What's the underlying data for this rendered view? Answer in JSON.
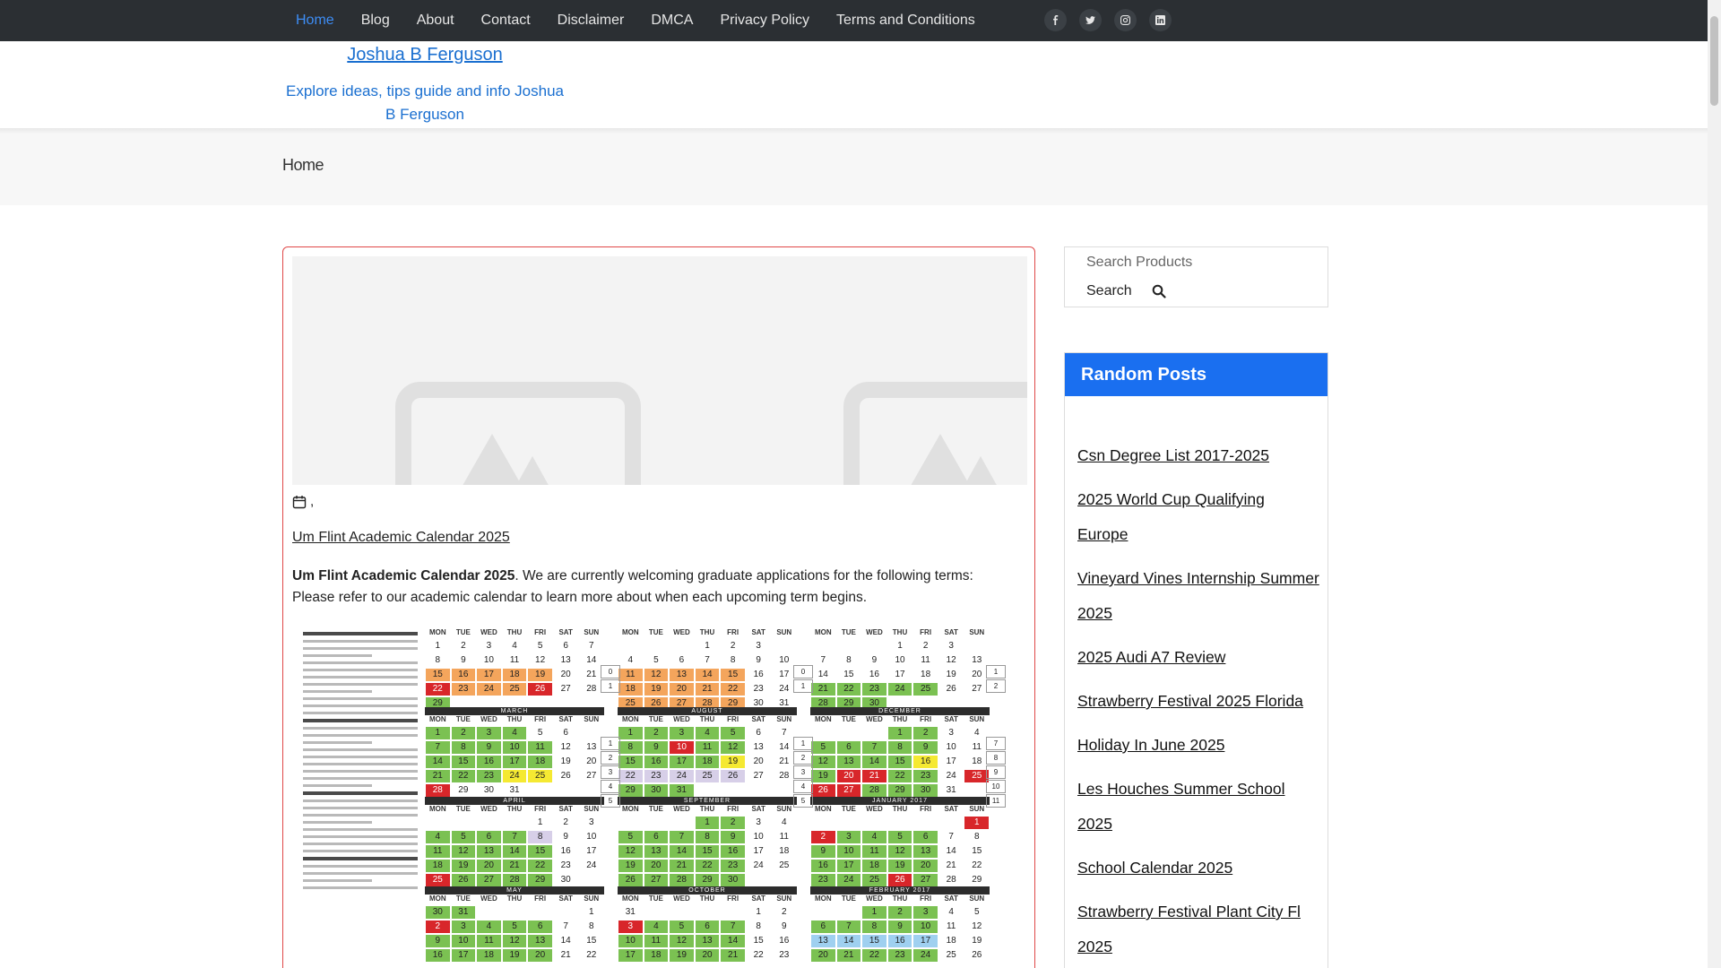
{
  "nav": {
    "items": [
      "Home",
      "Blog",
      "About",
      "Contact",
      "Disclaimer",
      "DMCA",
      "Privacy Policy",
      "Terms and Conditions"
    ],
    "active": "Home"
  },
  "social": [
    "facebook-icon",
    "twitter-icon",
    "instagram-icon",
    "linkedin-icon"
  ],
  "header": {
    "site_title": "Joshua B Ferguson",
    "tagline": "Explore ideas, tips guide and info Joshua B Ferguson"
  },
  "breadcrumb": "Home",
  "post": {
    "meta_separator": ",",
    "title": "Um Flint Academic Calendar 2025",
    "excerpt_bold": "Um Flint Academic Calendar 2025",
    "excerpt_rest": ". We are currently welcoming graduate applications for the following terms: Please refer to our academic calendar to learn more about when each upcoming term begins."
  },
  "calendar_image": {
    "month_labels": [
      "MARCH",
      "AUGUST",
      "DECEMBER",
      "APRIL",
      "SEPTEMBER",
      "JANUARY 2017",
      "MAY",
      "OCTOBER",
      "FEBRUARY 2017"
    ],
    "day_headers": [
      "MON",
      "TUE",
      "WED",
      "THU",
      "FRI",
      "SAT",
      "SUN"
    ]
  },
  "search": {
    "placeholder": "Search Products",
    "button_label": "Search"
  },
  "random_posts": {
    "title": "Random Posts",
    "items": [
      "Csn Degree List 2017-2025",
      "2025 World Cup Qualifying Europe",
      "Vineyard Vines Internship Summer 2025",
      "2025 Audi A7 Review",
      "Strawberry Festival 2025 Florida",
      "Holiday In June 2025",
      "Les Houches Summer School 2025",
      "School Calendar 2025",
      "Strawberry Festival Plant City Fl 2025"
    ]
  }
}
